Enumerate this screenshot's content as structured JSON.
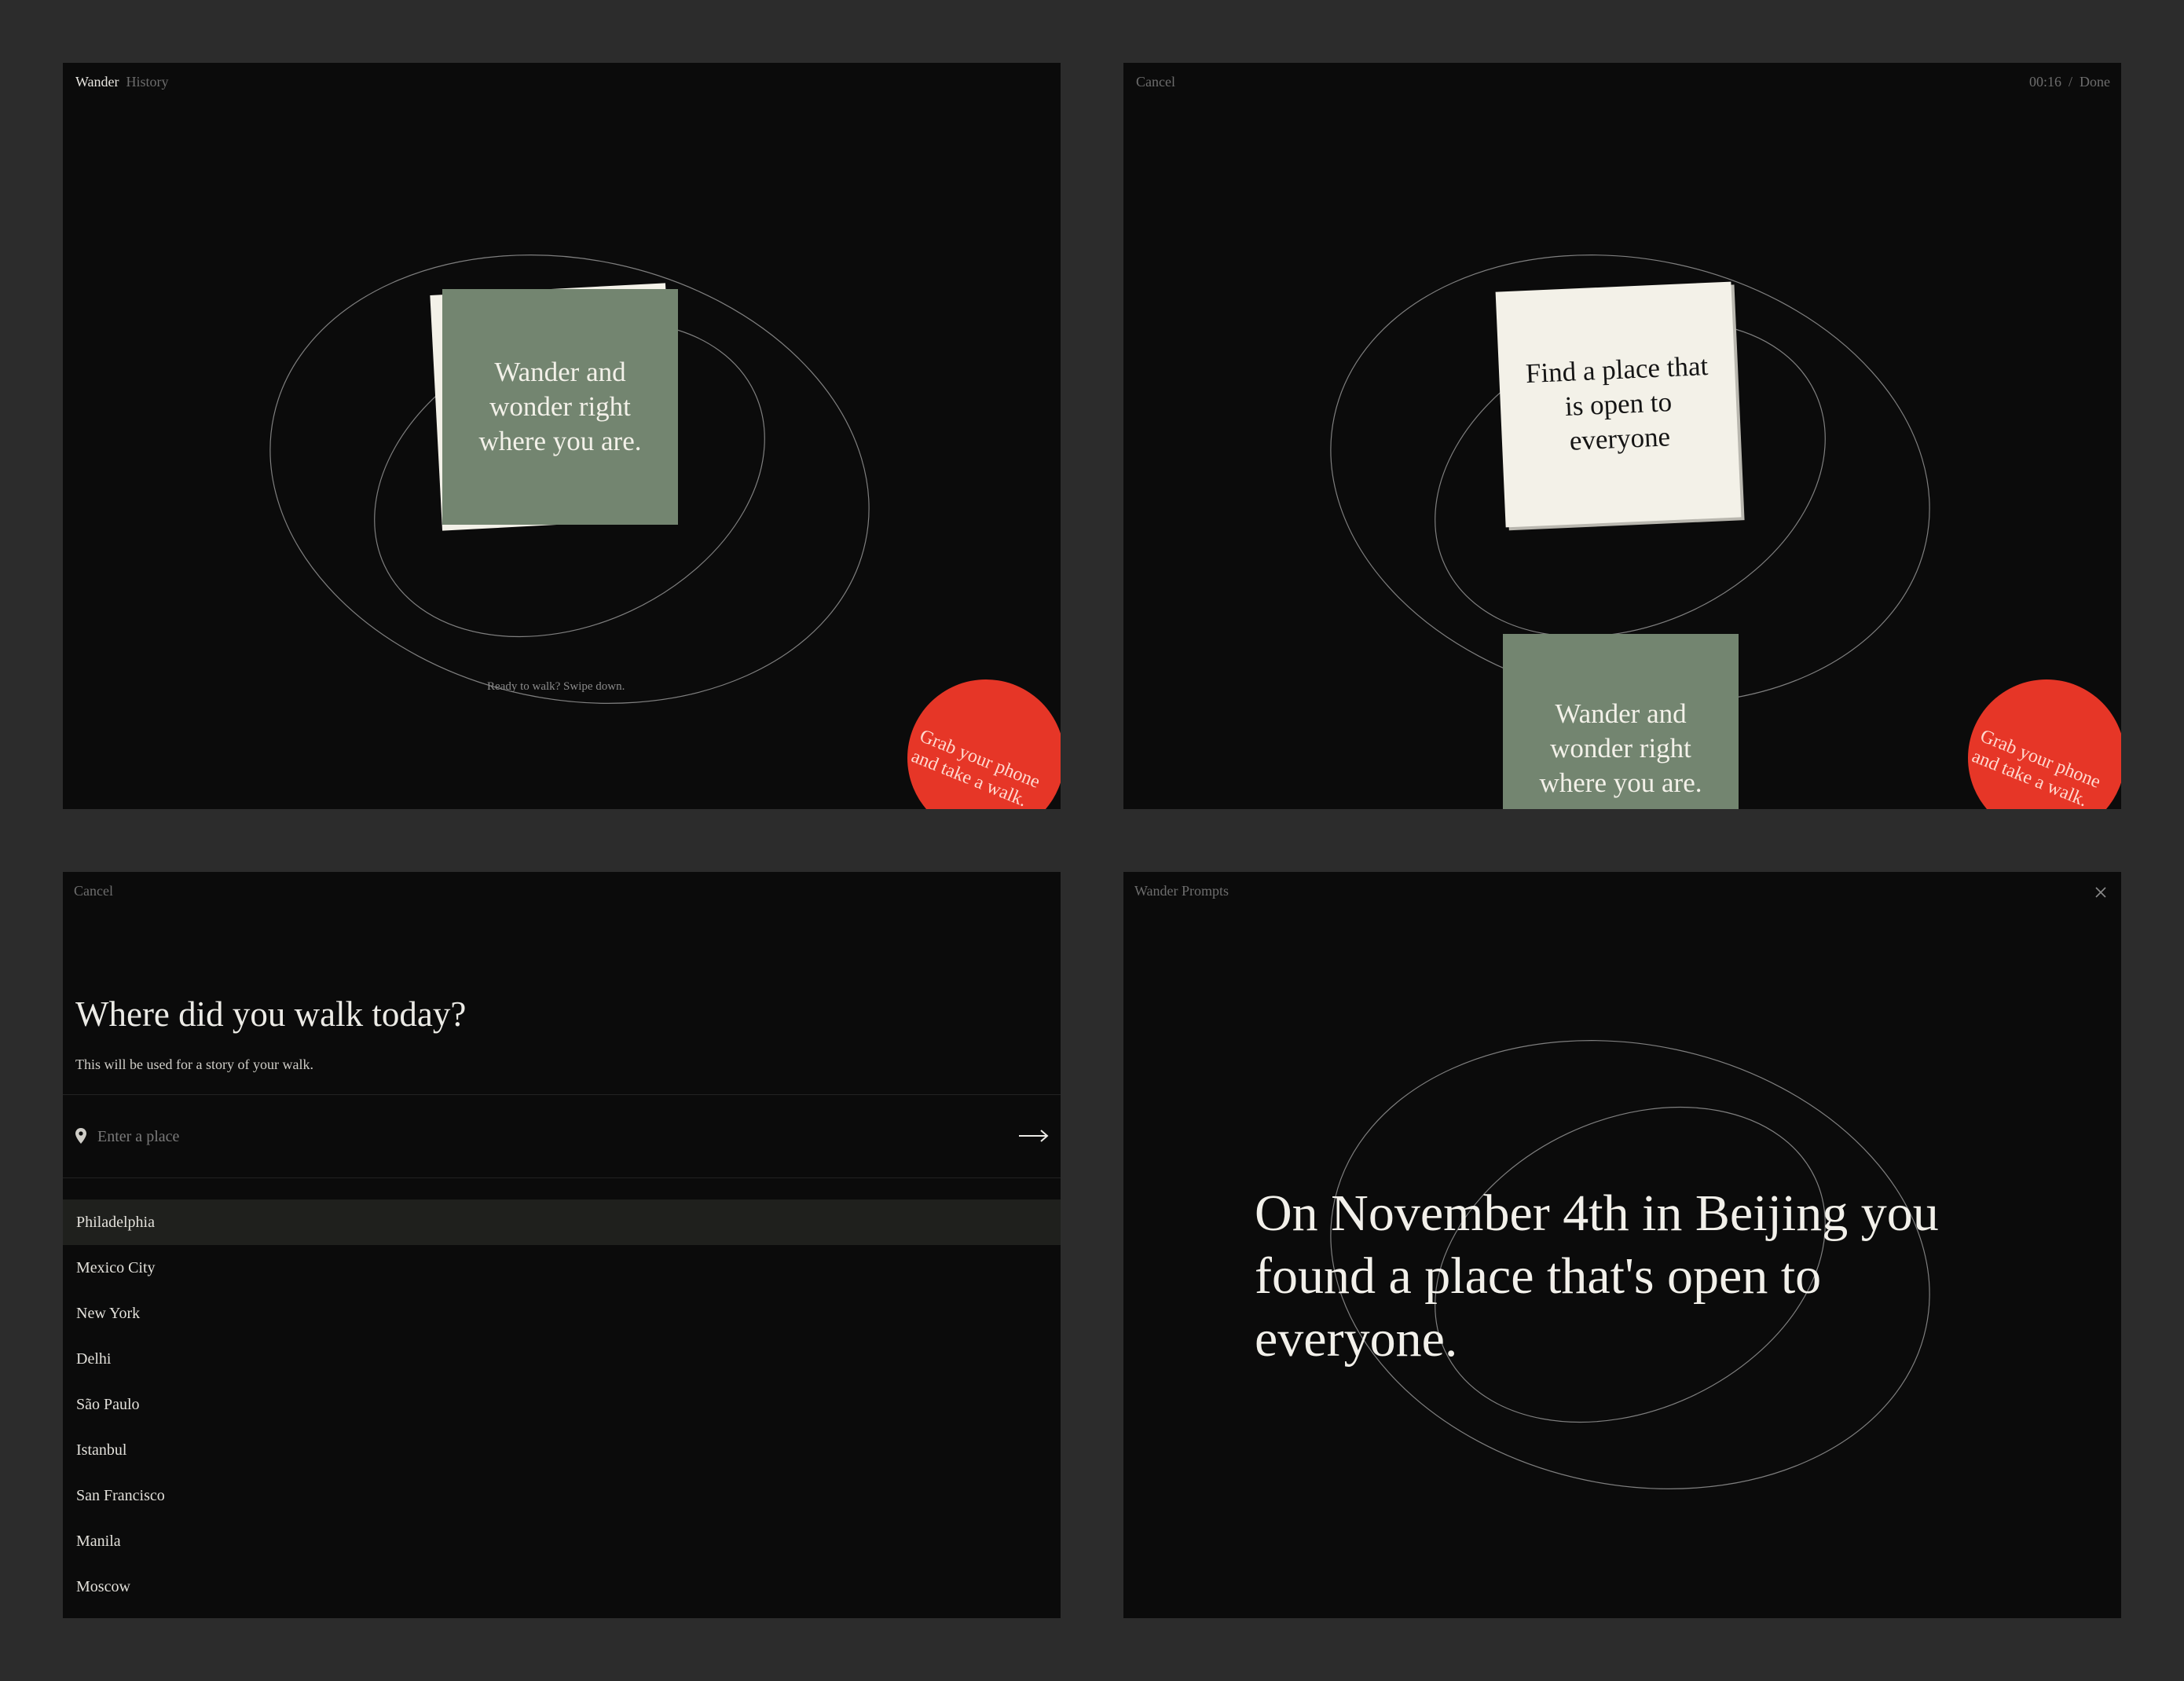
{
  "screen_home": {
    "nav": {
      "app_label": "Wander",
      "history_label": "History"
    },
    "card_text": "Wander and wonder right where you are.",
    "hint": "Ready to walk? Swipe down.",
    "badge_text_1": "Grab your phone",
    "badge_text_2": "and take a walk."
  },
  "screen_prompt": {
    "cancel_label": "Cancel",
    "timer": "00:16",
    "separator": "/",
    "done_label": "Done",
    "prompt_card_text": "Find a place that is open to everyone",
    "next_card_text": "Wander and wonder right where you are.",
    "badge_text_1": "Grab your phone",
    "badge_text_2": "and take a walk."
  },
  "screen_location": {
    "cancel_label": "Cancel",
    "title": "Where did you walk today?",
    "subtitle": "This will be used for a story of your walk.",
    "input": {
      "placeholder": "Enter a place",
      "value": ""
    },
    "cities": [
      "Philadelphia",
      "Mexico City",
      "New York",
      "Delhi",
      "São Paulo",
      "Istanbul",
      "San Francisco",
      "Manila",
      "Moscow"
    ],
    "selected_city": "Philadelphia"
  },
  "screen_story": {
    "title": "Wander Prompts",
    "story_text": "On November 4th in Beijing you found a place that's open to everyone."
  },
  "icons": [
    "close-icon",
    "location-pin-icon",
    "arrow-right-icon"
  ],
  "colors": {
    "background": "#0b0b0b",
    "frame": "#2c2c2c",
    "card_green": "#738570",
    "card_cream": "#f3f1e8",
    "accent_red": "#e63627"
  }
}
